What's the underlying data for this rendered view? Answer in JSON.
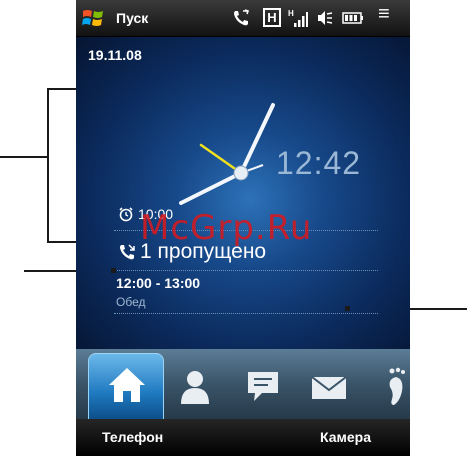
{
  "status_bar": {
    "start_label": "Пуск",
    "hsdpa_label": "H",
    "menu_glyph": "≡",
    "icons": [
      "windows-flag-icon",
      "phone-signal-icon",
      "hsdpa-icon",
      "signal-strength-icon",
      "speaker-icon",
      "battery-icon",
      "menu-icon"
    ]
  },
  "home": {
    "date": "19.11.08",
    "clock_time": "12:42",
    "alarm_time": "10:00",
    "missed_calls": "1 пропущено",
    "appointment_time": "12:00 - 13:00",
    "appointment_title": "Обед"
  },
  "tabs": [
    {
      "icon": "home-icon",
      "active": true
    },
    {
      "icon": "person-icon",
      "active": false
    },
    {
      "icon": "message-icon",
      "active": false
    },
    {
      "icon": "mail-icon",
      "active": false
    },
    {
      "icon": "footprint-icon",
      "active": false
    }
  ],
  "softkeys": {
    "left": "Телефон",
    "right": "Камера"
  },
  "watermark": "McGrp.Ru",
  "colors": {
    "accent": "#1f7ac0",
    "hour_hand": "#ffffff",
    "second_hand": "#f0e020",
    "watermark": "#d7191e"
  }
}
